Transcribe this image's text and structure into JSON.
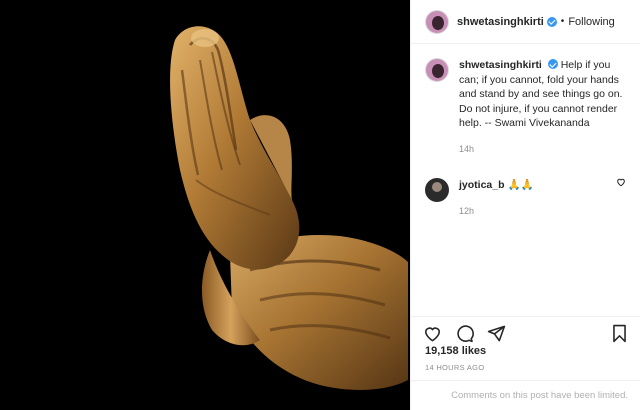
{
  "post": {
    "image_description_icon": "praying-hands-image"
  },
  "header": {
    "username": "shwetasinghkirti",
    "separator": "•",
    "follow_status": "Following"
  },
  "caption": {
    "username": "shwetasinghkirti",
    "text": "Help if you can; if you cannot, fold your hands and stand by and see things go on. Do not injure, if you cannot render help. -- Swami Vivekananda",
    "time": "14h"
  },
  "comments": [
    {
      "username": "jyotica_b",
      "text": "🙏🙏",
      "time": "12h"
    }
  ],
  "actions": {
    "like_icon": "heart-icon",
    "comment_icon": "comment-icon",
    "share_icon": "share-icon",
    "save_icon": "bookmark-icon"
  },
  "stats": {
    "likes": "19,158 likes",
    "posted": "14 HOURS AGO"
  },
  "footer": {
    "limited_text": "Comments on this post have been limited."
  },
  "colors": {
    "verified": "#3897f0",
    "secondary_text": "#8e8e8e",
    "gold": "#b8863c"
  }
}
